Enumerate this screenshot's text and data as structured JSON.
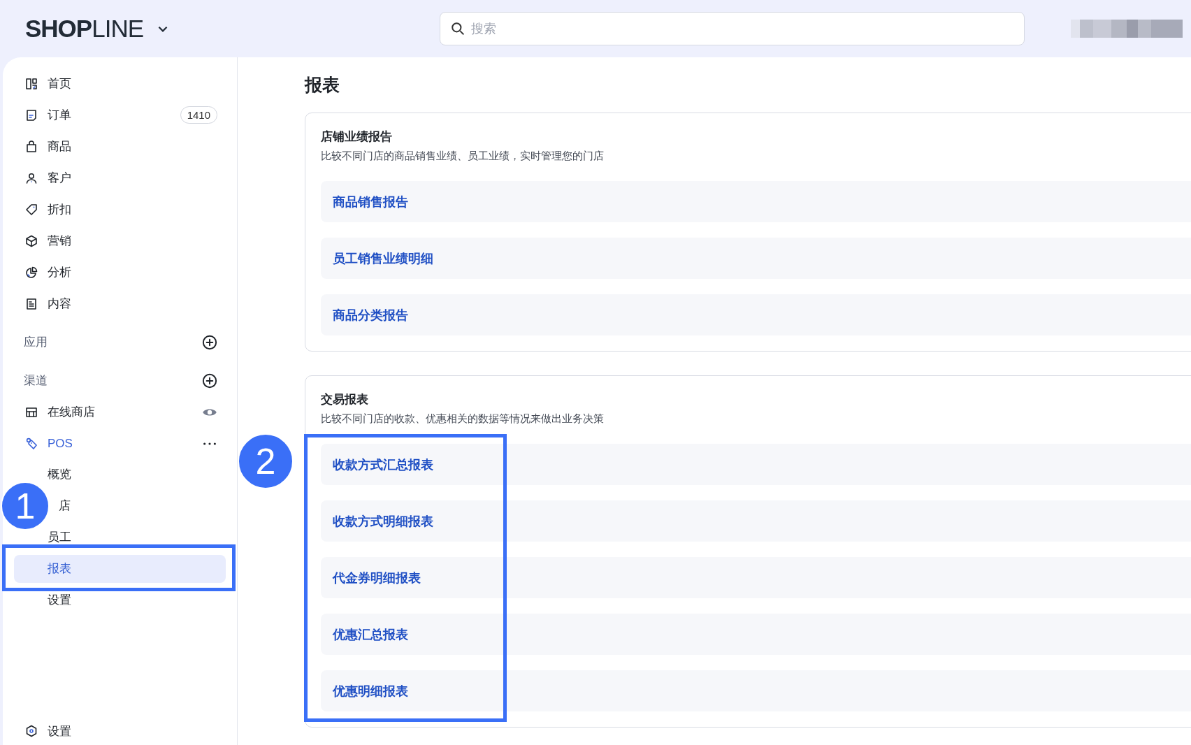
{
  "header": {
    "logo": "**SHOP**LINE",
    "search": {
      "placeholder": "搜索"
    }
  },
  "sidebar": {
    "items": [
      {
        "label": "首页"
      },
      {
        "label": "订单",
        "badge": "1410"
      },
      {
        "label": "商品"
      },
      {
        "label": "客户"
      },
      {
        "label": "折扣"
      },
      {
        "label": "营销"
      },
      {
        "label": "分析"
      },
      {
        "label": "内容"
      }
    ],
    "sections": [
      {
        "title": "应用"
      },
      {
        "title": "渠道",
        "items": [
          {
            "label": "在线商店",
            "expanded": false
          },
          {
            "label": "POS",
            "expanded": true,
            "children": [
              {
                "label": "概览",
                "kind": "whole",
                "selected": false
              },
              {
                "label": "店",
                "kind": "cut",
                "selected": false
              },
              {
                "label": "员工",
                "kind": "whole",
                "selected": false
              },
              {
                "label": "报表",
                "kind": "whole",
                "selected": true
              },
              {
                "label": "设置",
                "kind": "whole",
                "selected": false
              }
            ]
          }
        ]
      }
    ],
    "footer": {
      "label": "设置"
    }
  },
  "page": {
    "title": "报表",
    "cards": [
      {
        "title": "店铺业绩报告",
        "description": "比较不同门店的商品销售业绩、员工业绩，实时管理您的门店",
        "links": [
          "商品销售报告",
          "员工销售业绩明细",
          "商品分类报告"
        ]
      },
      {
        "title": "交易报表",
        "description": "比较不同门店的收款、优惠相关的数据等情况来做出业务决策",
        "links": [
          "收款方式汇总报表",
          "收款方式明细报表",
          "代金券明细报表",
          "优惠汇总报表",
          "优惠明细报表"
        ]
      }
    ]
  },
  "annotations": [
    {
      "label": "1"
    },
    {
      "label": "2"
    }
  ]
}
